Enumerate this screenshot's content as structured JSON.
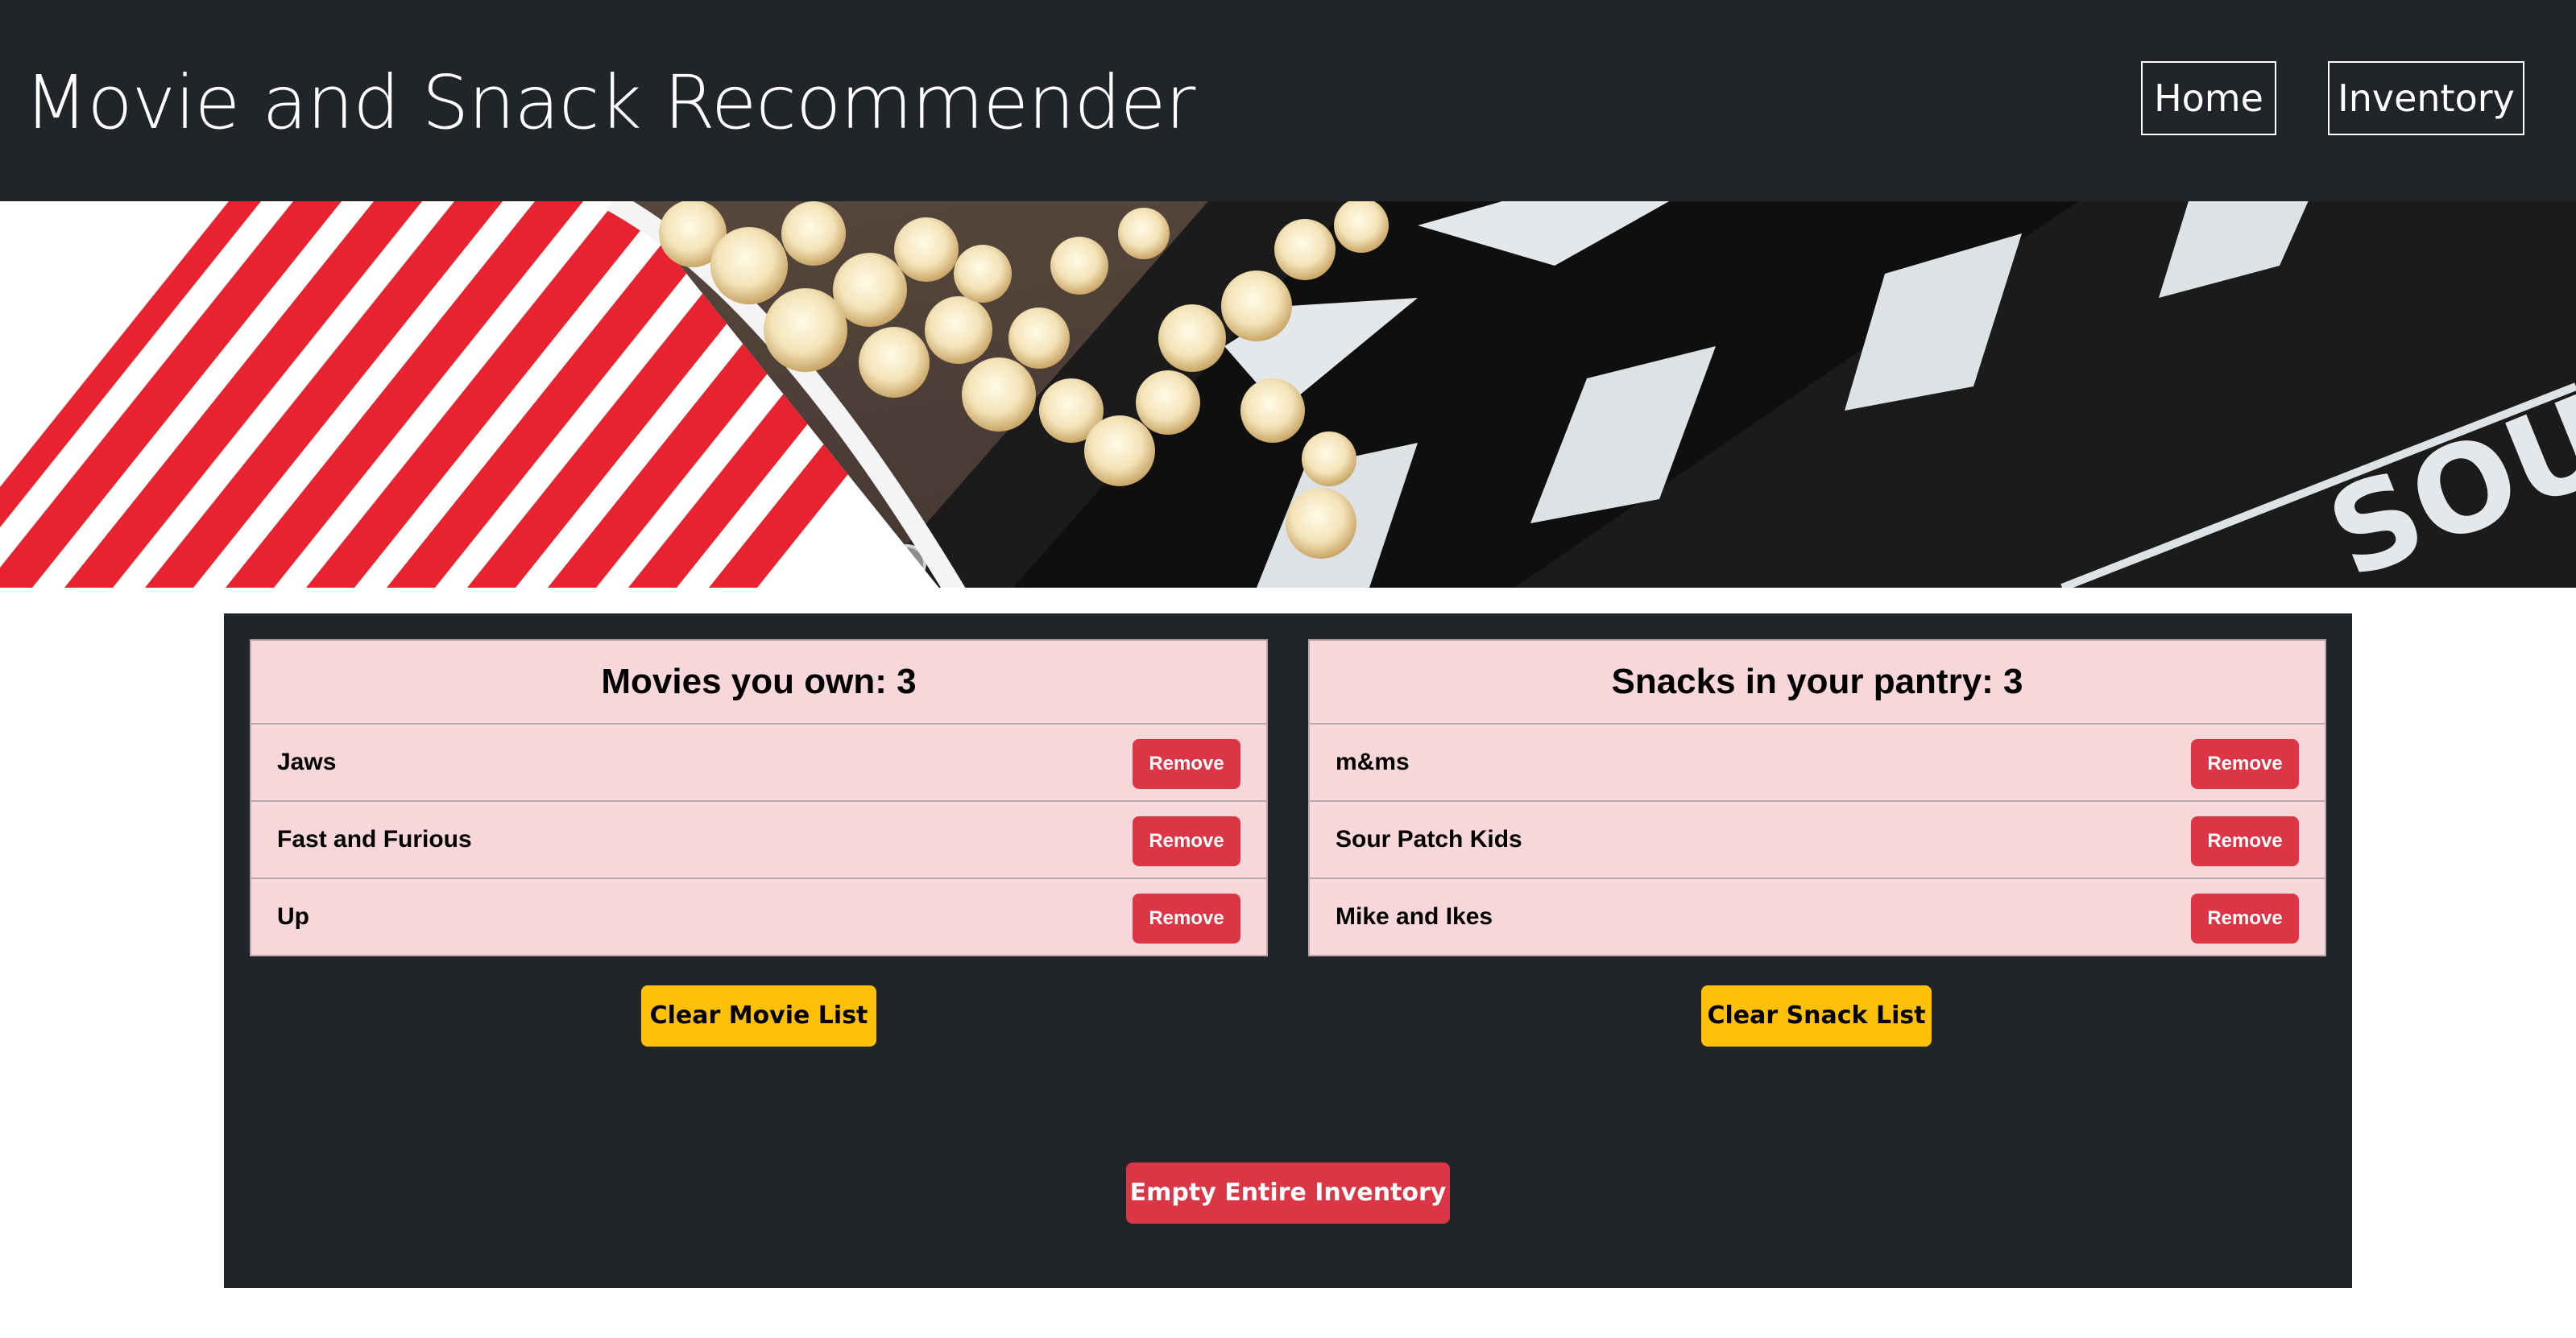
{
  "header": {
    "title": "Movie and Snack Recommender",
    "nav": [
      {
        "label": "Home"
      },
      {
        "label": "Inventory"
      }
    ]
  },
  "hero": {
    "description_icons": [
      "popcorn-icon",
      "clapperboard-icon"
    ],
    "clapper_text": "SOU"
  },
  "movies": {
    "title": "Movies you own: 3",
    "items": [
      {
        "label": "Jaws",
        "action": "Remove"
      },
      {
        "label": "Fast and Furious",
        "action": "Remove"
      },
      {
        "label": "Up",
        "action": "Remove"
      }
    ],
    "clear_label": "Clear Movie List"
  },
  "snacks": {
    "title": "Snacks in your pantry: 3",
    "items": [
      {
        "label": "m&ms",
        "action": "Remove"
      },
      {
        "label": "Sour Patch Kids",
        "action": "Remove"
      },
      {
        "label": "Mike and Ikes",
        "action": "Remove"
      }
    ],
    "clear_label": "Clear Snack List"
  },
  "empty_label": "Empty Entire Inventory",
  "colors": {
    "header_bg": "#212529",
    "panel_bg": "#212529",
    "card_bg": "#f8d7da",
    "danger": "#dc3545",
    "warning": "#ffc107"
  }
}
